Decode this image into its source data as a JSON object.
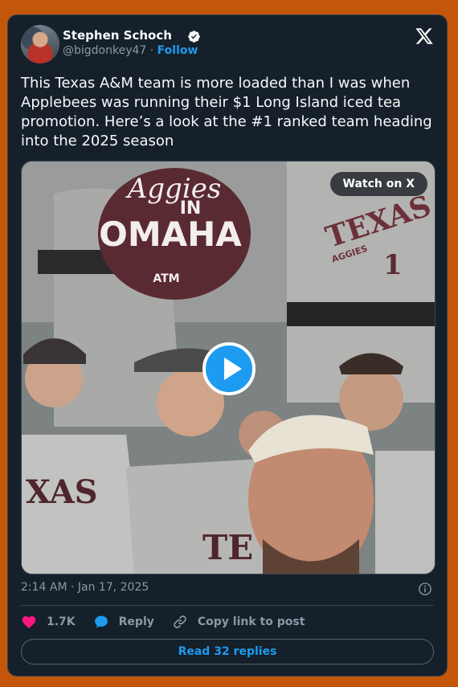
{
  "author": {
    "name": "Stephen Schoch",
    "handle": "@bigdonkey47",
    "separator": " · ",
    "follow_label": "Follow"
  },
  "tweet": {
    "text": "This Texas A&M team is more loaded than I was when Applebees was running their $1 Long Island iced tea promotion. Here’s a look at the #1 ranked team heading into the 2025 season"
  },
  "media": {
    "watch_label": "Watch on X",
    "sign_line1": "Aggies",
    "sign_line2": "IN",
    "sign_line3": "OMAHA",
    "sign_small": "ATM",
    "jersey_right": "TEXAS",
    "jersey_right_sub": "AGGIES",
    "jersey_number": "1",
    "jersey_left": "XAS",
    "jersey_front": "TE"
  },
  "timestamp": "2:14 AM · Jan 17, 2025",
  "actions": {
    "likes": "1.7K",
    "reply_label": "Reply",
    "copy_label": "Copy link to post"
  },
  "read_replies_label": "Read 32 replies",
  "colors": {
    "background": "#c4560a",
    "card": "#15202b",
    "accent": "#1d9bf0",
    "like": "#f91880",
    "muted": "#8b98a5"
  },
  "icons": [
    "verified-badge-icon",
    "x-logo-icon",
    "info-icon",
    "heart-icon",
    "reply-bubble-icon",
    "link-icon",
    "play-icon"
  ]
}
